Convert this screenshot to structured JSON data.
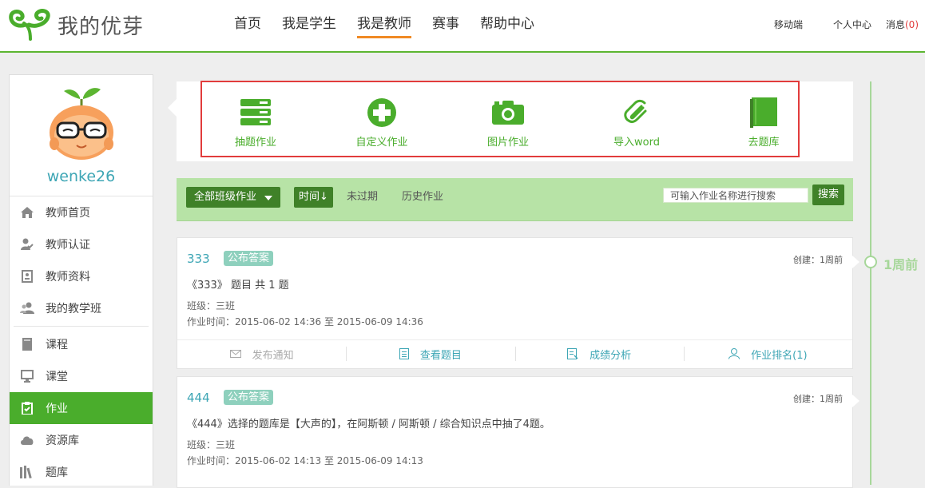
{
  "header": {
    "logo_text": "我的优芽",
    "nav": [
      {
        "label": "首页"
      },
      {
        "label": "我是学生"
      },
      {
        "label": "我是教师"
      },
      {
        "label": "赛事"
      },
      {
        "label": "帮助中心"
      }
    ],
    "active_nav": "我是教师",
    "mobile": "移动端",
    "personal": "个人中心",
    "messages": "消息",
    "message_count": "(0)"
  },
  "sidebar": {
    "username": "wenke26",
    "items": [
      {
        "label": "教师首页",
        "icon": "home-icon"
      },
      {
        "label": "教师认证",
        "icon": "user-check-icon"
      },
      {
        "label": "教师资料",
        "icon": "profile-card-icon"
      },
      {
        "label": "我的教学班",
        "icon": "class-group-icon"
      },
      {
        "label": "课程",
        "icon": "book-icon"
      },
      {
        "label": "课堂",
        "icon": "monitor-icon"
      },
      {
        "label": "作业",
        "icon": "clipboard-check-icon"
      },
      {
        "label": "资源库",
        "icon": "cloud-icon"
      },
      {
        "label": "题库",
        "icon": "library-icon"
      }
    ],
    "active": "作业"
  },
  "tools": [
    {
      "label": "抽题作业",
      "icon": "stack-icon"
    },
    {
      "label": "自定义作业",
      "icon": "plus-circle-icon"
    },
    {
      "label": "图片作业",
      "icon": "camera-icon"
    },
    {
      "label": "导入word",
      "icon": "paperclip-icon"
    },
    {
      "label": "去题库",
      "icon": "book-icon"
    }
  ],
  "filter": {
    "class_dropdown": "全部班级作业",
    "sort": "时间↓",
    "tabs": [
      "未过期",
      "历史作业"
    ],
    "search_placeholder": "可输入作业名称进行搜索",
    "search_button": "搜索"
  },
  "timeline": {
    "label": "1周前"
  },
  "assignments": [
    {
      "title": "333",
      "tag": "公布答案",
      "created": "创建：1周前",
      "description": "《333》 题目 共 1 题",
      "class": "班级：三班",
      "time": "作业时间：2015-06-02 14:36 至 2015-06-09 14:36",
      "actions": [
        "发布通知",
        "查看题目",
        "成绩分析",
        "作业排名(1)"
      ]
    },
    {
      "title": "444",
      "tag": "公布答案",
      "created": "创建：1周前",
      "description": "《444》选择的题库是【大声的】，在阿斯顿 / 阿斯顿 / 综合知识点中抽了4题。",
      "class": "班级：三班",
      "time": "作业时间：2015-06-02 14:13 至 2015-06-09 14:13"
    }
  ],
  "colors": {
    "brand_green": "#4aad2c",
    "dark_green": "#3f8128",
    "filter_bg": "#b7e3a6",
    "link_teal": "#3ea6b5",
    "nav_active": "#f08a24",
    "highlight_red": "#e23c3c"
  }
}
